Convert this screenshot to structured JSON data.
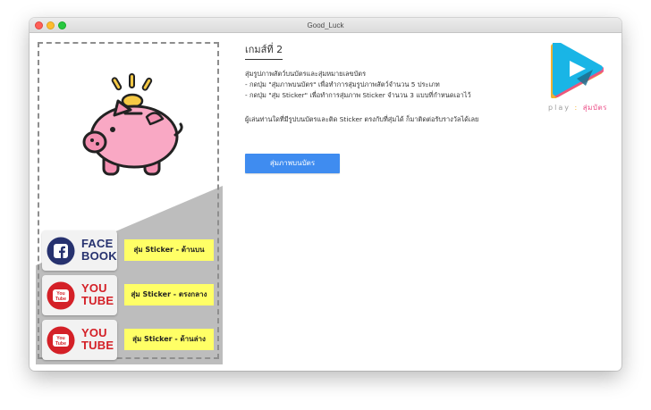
{
  "window": {
    "title": "Good_Luck"
  },
  "left_panel": {
    "rows": [
      {
        "logo_text": "FACE\nBOOK",
        "logo_icon": "facebook-icon",
        "button_label": "สุ่ม Sticker - ด้านบน"
      },
      {
        "logo_text": "YOU\nTUBE",
        "logo_icon": "youtube-icon",
        "logo_badge_text": "You Tube",
        "button_label": "สุ่ม Sticker - ตรงกลาง"
      },
      {
        "logo_text": "YOU\nTUBE",
        "logo_icon": "youtube-icon",
        "logo_badge_text": "You Tube",
        "button_label": "สุ่ม Sticker - ด้านล่าง"
      }
    ],
    "colors": {
      "sticker_button": "#ffff66",
      "panel_gray": "#bdbdbd",
      "piggy_pink": "#f9a8c4"
    }
  },
  "main": {
    "title": "เกมส์ที่ 2",
    "description": [
      "สุ่มรูปภาพสัตว์บนบัตรและสุ่มหมายเลขบัตร",
      "- กดปุ่ม \"สุ่มภาพบนบัตร\" เพื่อทำการสุ่มรูปภาพสัตว์จำนวน 5 ประเภท",
      "- กดปุ่ม \"สุ่ม Sticker\" เพื่อทำการสุ่มภาพ Sticker จำนวน 3 แบบที่กำหนดเอาไว้"
    ],
    "note": "ผู้เล่นท่านใดที่มีรูปบนบัตรและติด Sticker ตรงกับที่สุ่มได้ ก็มาติดต่อรับรางวัลได้เลย",
    "draw_button_label": "สุ่มภาพบนบัตร",
    "draw_button_color": "#3f8cf0"
  },
  "brand": {
    "play": "play",
    "separator": ":",
    "name": "สุ่มบัตร"
  }
}
